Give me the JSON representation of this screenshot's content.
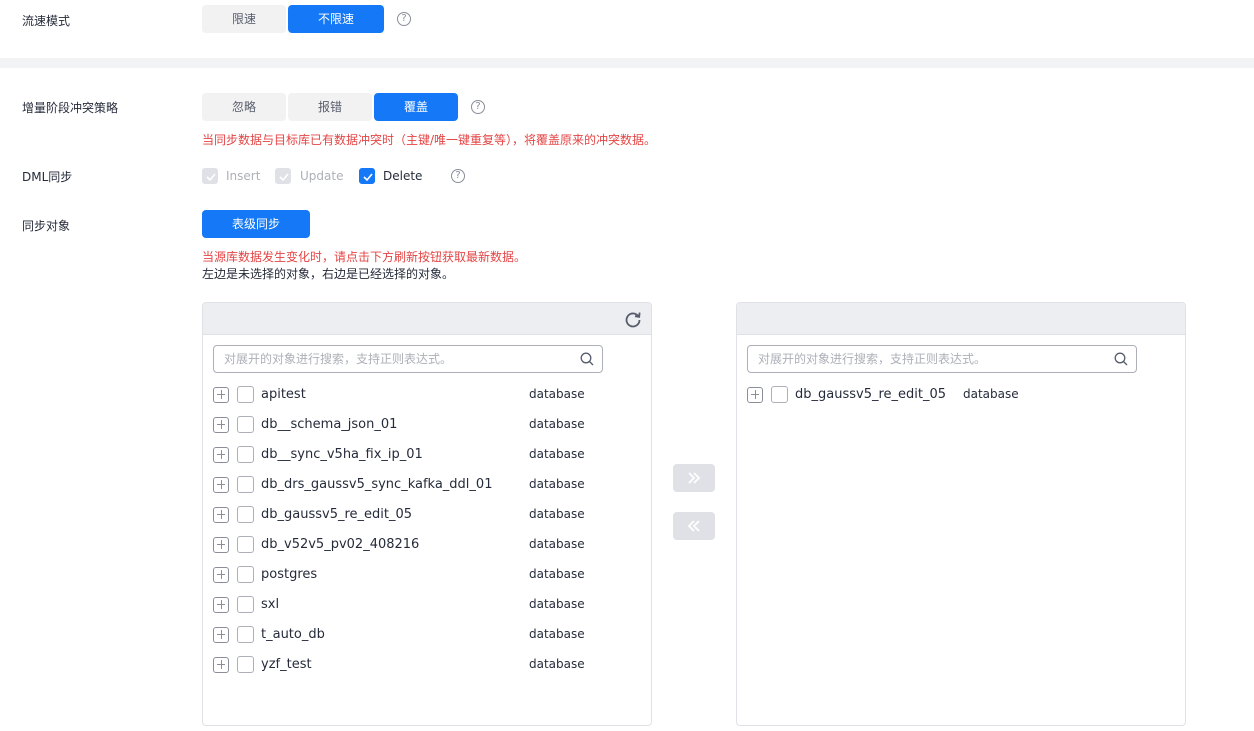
{
  "flow_mode": {
    "label": "流速模式",
    "options": [
      "限速",
      "不限速"
    ],
    "selected": "不限速"
  },
  "conflict": {
    "label": "增量阶段冲突策略",
    "options": [
      "忽略",
      "报错",
      "覆盖"
    ],
    "selected": "覆盖",
    "hint": "当同步数据与目标库已有数据冲突时（主键/唯一键重复等），将覆盖原来的冲突数据。"
  },
  "dml": {
    "label": "DML同步",
    "items": [
      {
        "label": "Insert",
        "checked": true,
        "disabled": true
      },
      {
        "label": "Update",
        "checked": true,
        "disabled": true
      },
      {
        "label": "Delete",
        "checked": true,
        "disabled": false
      }
    ]
  },
  "sync_object": {
    "label": "同步对象",
    "button": "表级同步",
    "hint_red": "当源库数据发生变化时，请点击下方刷新按钮获取最新数据。",
    "hint": "左边是未选择的对象，右边是已经选择的对象。"
  },
  "left_panel": {
    "search_placeholder": "对展开的对象进行搜索，支持正则表达式。",
    "items": [
      {
        "name": "apitest",
        "type": "database"
      },
      {
        "name": "db__schema_json_01",
        "type": "database"
      },
      {
        "name": "db__sync_v5ha_fix_ip_01",
        "type": "database"
      },
      {
        "name": "db_drs_gaussv5_sync_kafka_ddl_01",
        "type": "database"
      },
      {
        "name": "db_gaussv5_re_edit_05",
        "type": "database"
      },
      {
        "name": "db_v52v5_pv02_408216",
        "type": "database"
      },
      {
        "name": "postgres",
        "type": "database"
      },
      {
        "name": "sxl",
        "type": "database"
      },
      {
        "name": "t_auto_db",
        "type": "database"
      },
      {
        "name": "yzf_test",
        "type": "database"
      }
    ]
  },
  "right_panel": {
    "search_placeholder": "对展开的对象进行搜索，支持正则表达式。",
    "items": [
      {
        "name": "db_gaussv5_re_edit_05",
        "type": "database"
      }
    ]
  },
  "icons": {
    "help": "help-icon",
    "refresh": "refresh-icon",
    "search": "search-icon",
    "move_right": "double-chevron-right-icon",
    "move_left": "double-chevron-left-icon"
  },
  "colors": {
    "primary": "#1478f7",
    "danger": "#e54545",
    "disabled": "#dfe1e6"
  }
}
